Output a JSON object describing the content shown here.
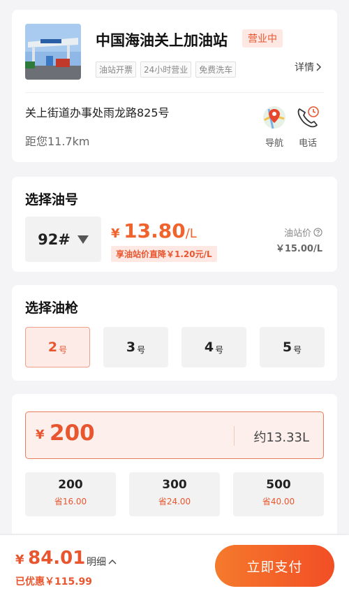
{
  "station": {
    "name": "中国海油关上加油站",
    "status": "营业中",
    "tags": [
      "油站开票",
      "24小时营业",
      "免费洗车"
    ],
    "detail_label": "详情",
    "address": "关上街道办事处雨龙路825号",
    "distance": "距您11.7km",
    "nav_label": "导航",
    "call_label": "电话"
  },
  "oil": {
    "title": "选择油号",
    "grade": "92#",
    "price_symbol": "¥",
    "price": "13.80",
    "price_unit": "/L",
    "discount": "享油站价直降￥1.20元/L",
    "ref_label": "油站价",
    "ref_price": "￥15.00/L"
  },
  "gun": {
    "title": "选择油枪",
    "suffix": "号",
    "options": [
      {
        "num": "2",
        "active": true
      },
      {
        "num": "3",
        "active": false
      },
      {
        "num": "4",
        "active": false
      },
      {
        "num": "5",
        "active": false
      }
    ]
  },
  "amount": {
    "symbol": "¥",
    "value": "200",
    "liters": "约13.33L",
    "presets": [
      {
        "value": "200",
        "save": "省16.00"
      },
      {
        "value": "300",
        "save": "省24.00"
      },
      {
        "value": "500",
        "save": "省40.00"
      }
    ]
  },
  "footer": {
    "symbol": "¥",
    "total": "84.01",
    "detail_label": "明细",
    "saved": "已优惠￥115.99",
    "pay_label": "立即支付"
  },
  "colors": {
    "accent": "#e8562f",
    "accent_light": "#fde8e4",
    "page_bg": "#f4f4f6"
  }
}
